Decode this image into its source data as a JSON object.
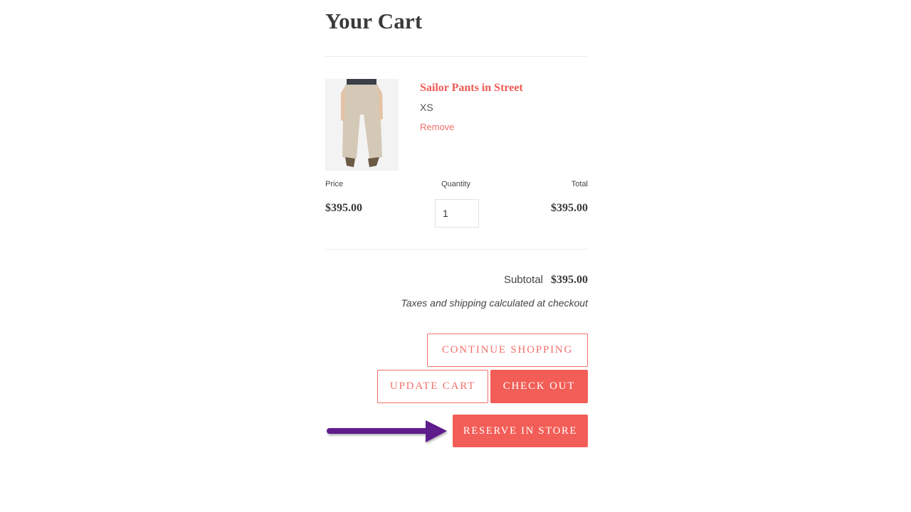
{
  "page": {
    "title": "Your Cart"
  },
  "item": {
    "name": "Sailor Pants in Street",
    "variant": "XS",
    "remove_label": "Remove",
    "image_alt": "Sailor Pants in Street product photo",
    "price": "$395.00",
    "quantity": "1",
    "total": "$395.00"
  },
  "columns": {
    "price": "Price",
    "quantity": "Quantity",
    "total": "Total"
  },
  "summary": {
    "subtotal_label": "Subtotal",
    "subtotal_value": "$395.00",
    "tax_note": "Taxes and shipping calculated at checkout"
  },
  "buttons": {
    "continue_shopping": "CONTINUE SHOPPING",
    "update_cart": "UPDATE CART",
    "check_out": "CHECK OUT",
    "reserve_in_store": "RESERVE IN STORE"
  },
  "annotation": {
    "arrow_icon": "arrow-right-icon",
    "arrow_color": "#5e1f8c"
  },
  "colors": {
    "accent": "#f25e57",
    "accent_outline": "#f2706b",
    "text": "#3a3a3a"
  }
}
